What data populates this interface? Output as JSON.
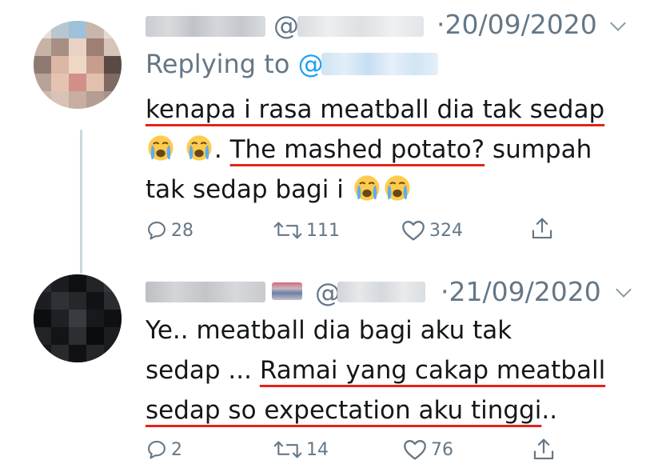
{
  "tweets": [
    {
      "avatar_icon": "pixelated-avatar-icon",
      "at": "@",
      "date": "·20/09/2020",
      "replying_prefix": "Replying to ",
      "mention_at": "@",
      "text_line1": "kenapa i rasa meatball dia tak sedap",
      "text_line2_prefix": ". ",
      "text_line2_underlined": "The mashed potato?",
      "text_line2_suffix": " sumpah",
      "text_line3": "tak sedap bagi i ",
      "emoji": "loudly-crying-face",
      "reply_count": "28",
      "retweet_count": "111",
      "like_count": "324"
    },
    {
      "avatar_icon": "pixelated-avatar-icon",
      "at": "@",
      "date": "·21/09/2020",
      "text_line1": "Ye.. meatball dia bagi aku tak",
      "text_line2_prefix": "sedap ... ",
      "text_line2_underlined": "Ramai yang cakap meatball",
      "text_line3_underlined": "sedap so expectation aku tinggi",
      "text_line3_suffix": "..",
      "reply_count": "2",
      "retweet_count": "14",
      "like_count": "76"
    }
  ],
  "colors": {
    "text": "#14171a",
    "muted": "#657786",
    "link": "#1da1f2",
    "underline_annotation": "#e2231a",
    "thread_line": "#ccd6dd"
  }
}
